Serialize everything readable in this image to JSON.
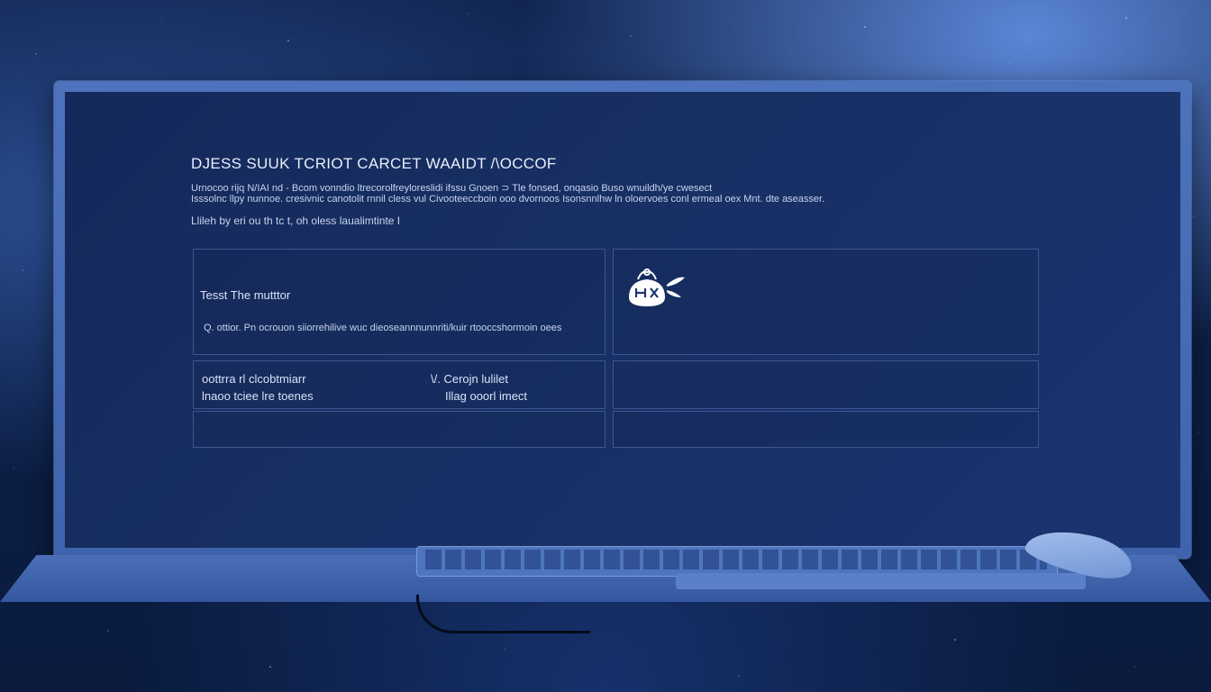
{
  "screen": {
    "title": "DJESS SUUK TCRIOT CARCET WAAIDT /\\OCCOF",
    "description_line1": "Urnocoo rijq N/IAI nd - Bcom vonndio ltrecorolfreyloreslidi ifssu Gnoen ⊃ Tle fonsed, onqasio  Buso wnuildh/ye cwesect",
    "description_line2": "Isssolnc llpy nunnoe. cresivnic canotolit rnnil cless vul Civooteeccboin ooo dvornoos Isonsnnlhw ln oloervoes conl ermeal oex Mnt. dte aseasser.",
    "subtitle": "Llileh by eri ou th tc t, oh oless laualimtinte I"
  },
  "panels": {
    "top_left": {
      "heading": "Tesst The mutttor",
      "body": "Q. ottior. Pn ocrouon siiorrehilive wuc dieoseannnunnriti/kuir rtooccshormoin oees"
    },
    "mid_left": {
      "col1_line1": "oottrra rl clcobtmiarr",
      "col1_line2": "lnaoo tciee lre toenes",
      "col2_line1": "\\/. Cerojn lulilet",
      "col2_line2": "Illag ooorl imect"
    }
  },
  "icons": {
    "top_right": "bag-icon"
  },
  "colors": {
    "screen_bg": "#182f63",
    "frame": "#4d73bd",
    "text": "#e8eefb"
  }
}
